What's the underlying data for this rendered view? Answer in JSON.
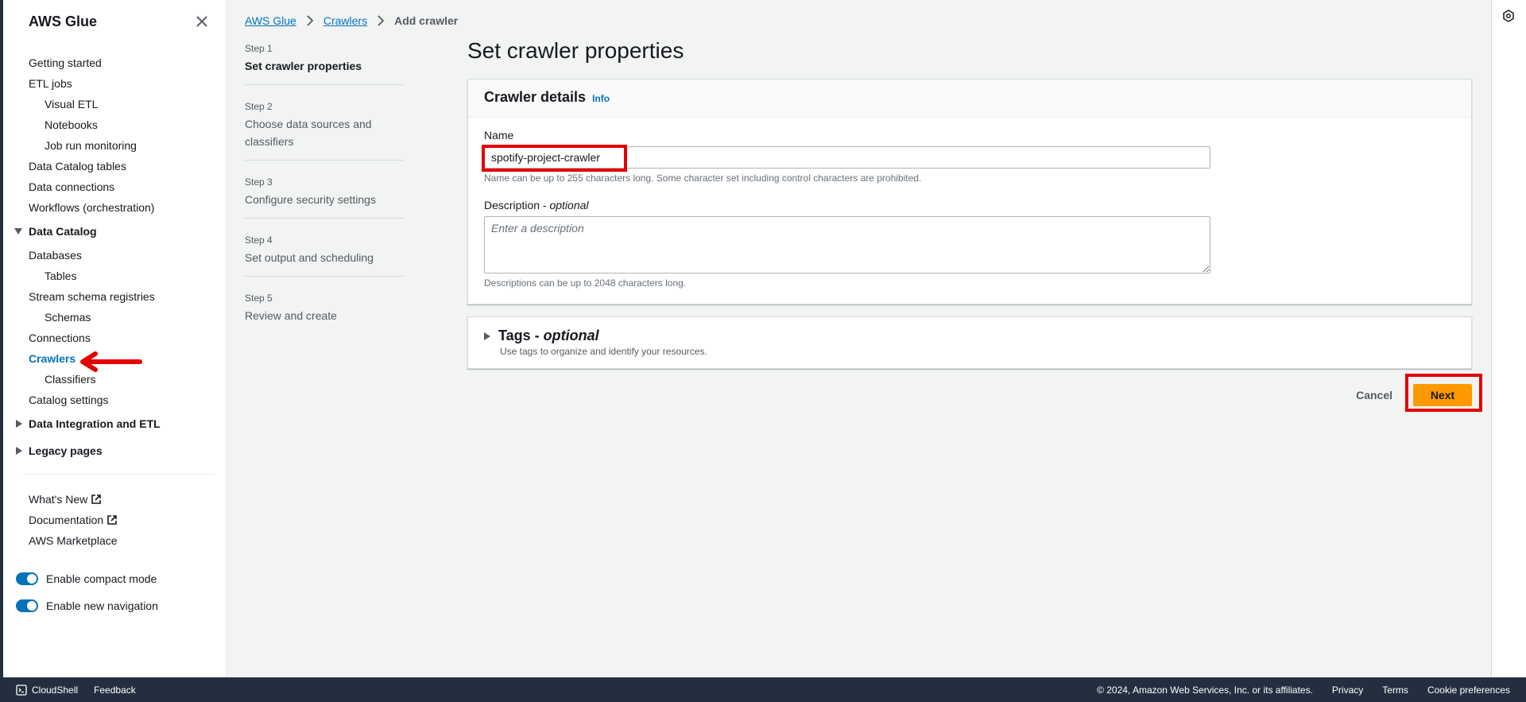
{
  "sidebar": {
    "title": "AWS Glue",
    "items_top": [
      {
        "label": "Getting started",
        "sub": false
      },
      {
        "label": "ETL jobs",
        "sub": false
      },
      {
        "label": "Visual ETL",
        "sub": true
      },
      {
        "label": "Notebooks",
        "sub": true
      },
      {
        "label": "Job run monitoring",
        "sub": true
      },
      {
        "label": "Data Catalog tables",
        "sub": false
      },
      {
        "label": "Data connections",
        "sub": false
      },
      {
        "label": "Workflows (orchestration)",
        "sub": false
      }
    ],
    "section_data_catalog": "Data Catalog",
    "items_catalog": [
      {
        "label": "Databases",
        "sub": false
      },
      {
        "label": "Tables",
        "sub": true
      },
      {
        "label": "Stream schema registries",
        "sub": false
      },
      {
        "label": "Schemas",
        "sub": true
      },
      {
        "label": "Connections",
        "sub": false
      },
      {
        "label": "Crawlers",
        "sub": false,
        "active": true
      },
      {
        "label": "Classifiers",
        "sub": true
      },
      {
        "label": "Catalog settings",
        "sub": false
      }
    ],
    "section_integration": "Data Integration and ETL",
    "section_legacy": "Legacy pages",
    "whats_new": "What's New",
    "documentation": "Documentation",
    "marketplace": "AWS Marketplace",
    "toggle_compact": "Enable compact mode",
    "toggle_navigation": "Enable new navigation"
  },
  "breadcrumb": {
    "root": "AWS Glue",
    "crawlers": "Crawlers",
    "current": "Add crawler"
  },
  "steps": [
    {
      "num": "Step 1",
      "title": "Set crawler properties"
    },
    {
      "num": "Step 2",
      "title": "Choose data sources and classifiers"
    },
    {
      "num": "Step 3",
      "title": "Configure security settings"
    },
    {
      "num": "Step 4",
      "title": "Set output and scheduling"
    },
    {
      "num": "Step 5",
      "title": "Review and create"
    }
  ],
  "main": {
    "page_title": "Set crawler properties",
    "details_title": "Crawler details",
    "info": "Info",
    "name_label": "Name",
    "name_value": "spotify-project-crawler",
    "name_constraint": "Name can be up to 255 characters long. Some character set including control characters are prohibited.",
    "description_label": "Description - ",
    "optional": "optional",
    "description_placeholder": "Enter a description",
    "description_constraint": "Descriptions can be up to 2048 characters long.",
    "tags_title": "Tags - ",
    "tags_desc": "Use tags to organize and identify your resources.",
    "cancel": "Cancel",
    "next": "Next"
  },
  "footer": {
    "cloudshell": "CloudShell",
    "feedback": "Feedback",
    "copyright": "© 2024, Amazon Web Services, Inc. or its affiliates.",
    "privacy": "Privacy",
    "terms": "Terms",
    "cookies": "Cookie preferences"
  },
  "colors": {
    "accent": "#0073bb",
    "primary_button": "#ff9900",
    "annotation": "#e50000"
  }
}
